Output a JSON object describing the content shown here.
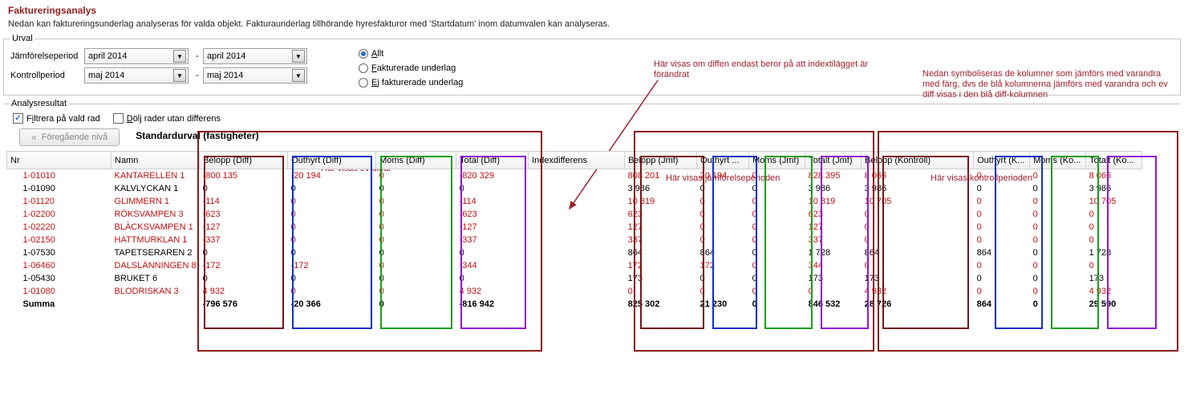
{
  "header": {
    "title": "Faktureringsanalys",
    "desc": "Nedan kan faktureringsunderlag analyseras för valda objekt. Fakturaunderlag tillhörande hyresfakturor med 'Startdatum' inom datumvalen kan analyseras."
  },
  "urval": {
    "legend": "Urval",
    "jmf_label": "Jämförelseperiod",
    "jmf_from": "april 2014",
    "jmf_to": "april 2014",
    "kontroll_label": "Kontrollperiod",
    "kontroll_from": "maj 2014",
    "kontroll_to": "maj 2014",
    "dash": "-",
    "radio_all": "Allt",
    "radio_fakt": "Fakturerade underlag",
    "radio_ej": "Ej fakturerade underlag"
  },
  "analys": {
    "legend": "Analysresultat",
    "filter_label": "Filtrera på vald rad",
    "hide_label": "Dölj rader utan differens",
    "prev_btn": "Föregående nivå",
    "std_label": "Standardurval (fastigheter)"
  },
  "annotations": {
    "a1": "Här visas om diffen endast beror på att indextilägget är förändrat",
    "a2": "Nedan symboliseras de kolumner som jämförs med varandra med färg, dvs de blå kolumnerna jämförs med varandra och ev diff visas i den blå diff-kolumnen",
    "a3": "Här visas ev diffar",
    "a4": "Här visas jämförelseperioden",
    "a5": "Här visas kontrollperioden"
  },
  "cols": {
    "nr": "Nr",
    "namn": "Namn",
    "belopp_diff": "Belopp (Diff)",
    "outhyrt_diff": "Outhyrt (Diff)",
    "moms_diff": "Moms (Diff)",
    "total_diff": "Total (Diff)",
    "indexdiff": "Indexdifferens",
    "belopp_jmf": "Belopp (Jmf)",
    "outhyrt_jmf": "Outhyrt ...",
    "moms_jmf": "Moms (Jmf)",
    "totalt_jmf": "Totalt (Jmf)",
    "belopp_k": "Belopp (Kontroll)",
    "outhyrt_k": "Outhyrt (K...",
    "moms_k": "Moms (Ko...",
    "totalt_k": "Totalt (Ko..."
  },
  "rows": [
    {
      "red": true,
      "nr": "1-01010",
      "namn": "KANTARELLEN 1",
      "bd": "-800 135",
      "od": "-20 194",
      "md": "0",
      "td": "-820 329",
      "id": "",
      "bj": "808 201",
      "oj": "20 194",
      "mj": "0",
      "tj": "828 395",
      "bk": "8 066",
      "ok": "0",
      "mk": "0",
      "tk": "8 066"
    },
    {
      "red": false,
      "nr": "1-01090",
      "namn": "KALVLYCKAN 1",
      "bd": "0",
      "od": "0",
      "md": "0",
      "td": "0",
      "id": "",
      "bj": "3 986",
      "oj": "0",
      "mj": "0",
      "tj": "3 986",
      "bk": "3 986",
      "ok": "0",
      "mk": "0",
      "tk": "3 986"
    },
    {
      "red": true,
      "nr": "1-01120",
      "namn": "GLIMMERN 1",
      "bd": "-114",
      "od": "0",
      "md": "0",
      "td": "-114",
      "id": "",
      "bj": "10 819",
      "oj": "0",
      "mj": "0",
      "tj": "10 819",
      "bk": "10 705",
      "ok": "0",
      "mk": "0",
      "tk": "10 705"
    },
    {
      "red": true,
      "nr": "1-02200",
      "namn": "RÖKSVAMPEN 3",
      "bd": "-623",
      "od": "0",
      "md": "0",
      "td": "-623",
      "id": "",
      "bj": "623",
      "oj": "0",
      "mj": "0",
      "tj": "623",
      "bk": "0",
      "ok": "0",
      "mk": "0",
      "tk": "0"
    },
    {
      "red": true,
      "nr": "1-02220",
      "namn": "BLÄCKSVAMPEN 1",
      "bd": "-127",
      "od": "0",
      "md": "0",
      "td": "-127",
      "id": "",
      "bj": "127",
      "oj": "0",
      "mj": "0",
      "tj": "127",
      "bk": "0",
      "ok": "0",
      "mk": "0",
      "tk": "0"
    },
    {
      "red": true,
      "nr": "1-02150",
      "namn": "HATTMURKLAN 1",
      "bd": "-337",
      "od": "0",
      "md": "0",
      "td": "-337",
      "id": "",
      "bj": "337",
      "oj": "0",
      "mj": "0",
      "tj": "337",
      "bk": "0",
      "ok": "0",
      "mk": "0",
      "tk": "0"
    },
    {
      "red": false,
      "nr": "1-07530",
      "namn": "TAPETSERAREN 2",
      "bd": "0",
      "od": "0",
      "md": "0",
      "td": "0",
      "id": "",
      "bj": "864",
      "oj": "864",
      "mj": "0",
      "tj": "1 728",
      "bk": "864",
      "ok": "864",
      "mk": "0",
      "tk": "1 728"
    },
    {
      "red": true,
      "nr": "1-06460",
      "namn": "DALSLÄNNINGEN 8",
      "bd": "-172",
      "od": "-172",
      "md": "0",
      "td": "-344",
      "id": "",
      "bj": "172",
      "oj": "172",
      "mj": "0",
      "tj": "344",
      "bk": "0",
      "ok": "0",
      "mk": "0",
      "tk": "0"
    },
    {
      "red": false,
      "nr": "1-05430",
      "namn": "BRUKET 6",
      "bd": "0",
      "od": "0",
      "md": "0",
      "td": "0",
      "id": "",
      "bj": "173",
      "oj": "0",
      "mj": "0",
      "tj": "173",
      "bk": "173",
      "ok": "0",
      "mk": "0",
      "tk": "173"
    },
    {
      "red": true,
      "nr": "1-01080",
      "namn": "BLODRISKAN 3",
      "bd": "4 932",
      "od": "0",
      "md": "0",
      "td": "4 932",
      "id": "",
      "bj": "0",
      "oj": "0",
      "mj": "0",
      "tj": "0",
      "bk": "4 932",
      "ok": "0",
      "mk": "0",
      "tk": "4 932"
    }
  ],
  "summa": {
    "nr": "Summa",
    "namn": "",
    "bd": "-796 576",
    "od": "-20 366",
    "md": "0",
    "td": "-816 942",
    "id": "",
    "bj": "825 302",
    "oj": "21 230",
    "mj": "0",
    "tj": "846 532",
    "bk": "28 726",
    "ok": "864",
    "mk": "0",
    "tk": "29 590"
  }
}
